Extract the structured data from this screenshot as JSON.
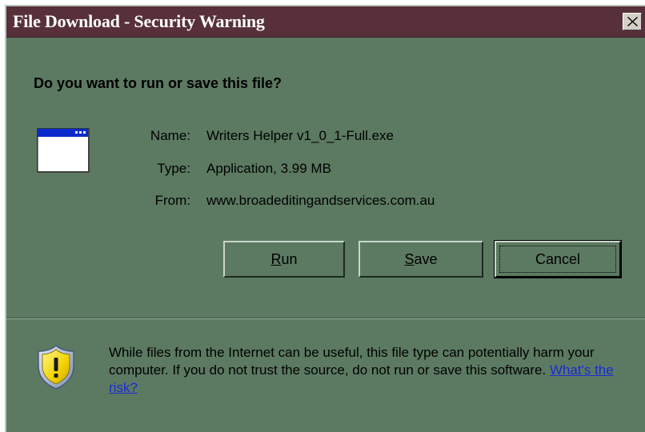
{
  "window": {
    "title": "File Download - Security Warning",
    "close_glyph": "×"
  },
  "prompt": {
    "question": "Do you want to run or save this file?"
  },
  "file_info": {
    "name_label": "Name:",
    "name_value": "Writers Helper v1_0_1-Full.exe",
    "type_label": "Type:",
    "type_value": "Application, 3.99 MB",
    "from_label": "From:",
    "from_value": "www.broadeditingandservices.com.au"
  },
  "buttons": {
    "run_mnemonic": "R",
    "run_rest": "un",
    "save_mnemonic": "S",
    "save_rest": "ave",
    "cancel_label": "Cancel"
  },
  "warning": {
    "text": "While files from the Internet can be useful, this file type can potentially harm your computer. If you do not trust the source, do not run or save this software.",
    "link_text": "What's the risk?"
  },
  "icons": {
    "app": "application-window-icon",
    "shield": "security-shield-warning-icon",
    "close": "close-icon"
  },
  "colors": {
    "dialog_bg": "#5c7a62",
    "titlebar_bg": "#58303a",
    "link": "#1a2ad8",
    "shield_yellow": "#f2d200"
  }
}
